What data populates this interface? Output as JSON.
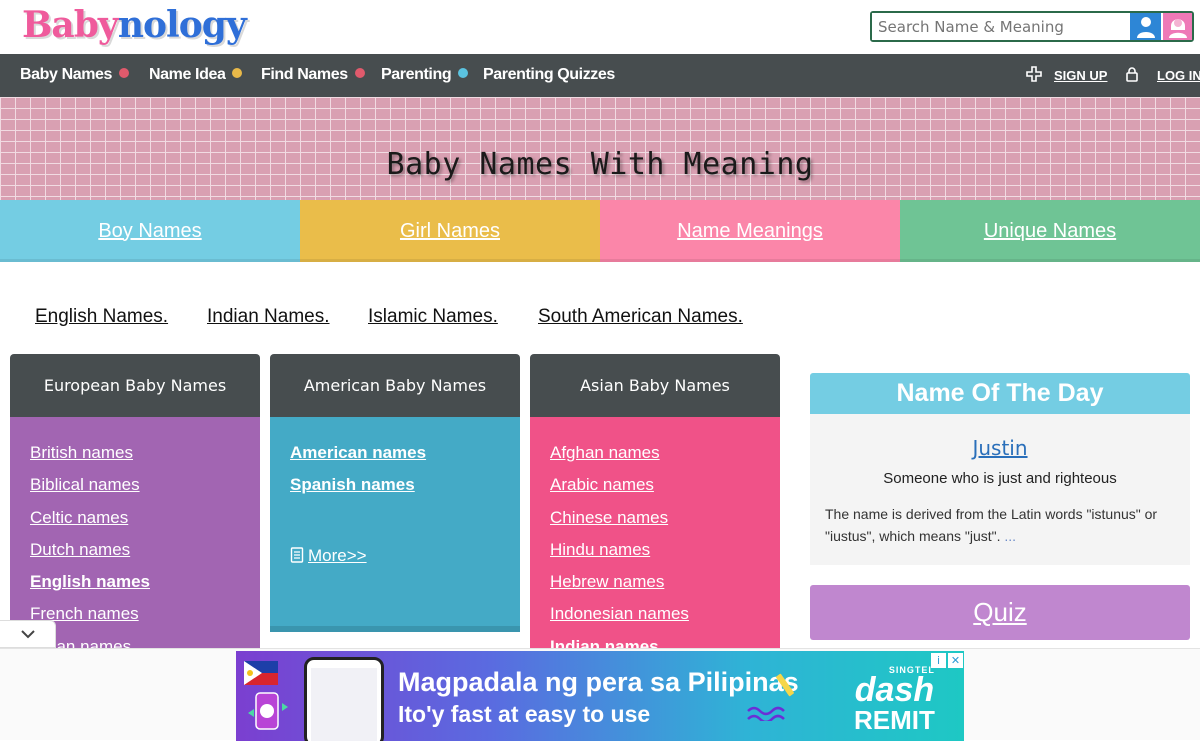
{
  "logo": {
    "part1": "Baby",
    "part2": "nology"
  },
  "search": {
    "placeholder": "Search Name & Meaning"
  },
  "nav": {
    "items": [
      {
        "label": "Baby Names",
        "dot": "#e05a6c"
      },
      {
        "label": "Name Idea",
        "dot": "#e9b949"
      },
      {
        "label": "Find Names",
        "dot": "#e05a6c"
      },
      {
        "label": "Parenting",
        "dot": "#5bc3e0"
      },
      {
        "label": "Parenting Quizzes"
      }
    ],
    "signup": "SIGN UP",
    "login": "LOG IN"
  },
  "hero": {
    "title": "Baby Names With Meaning"
  },
  "tabs": [
    {
      "label": "Boy Names",
      "color": "#74cde3"
    },
    {
      "label": "Girl Names",
      "color": "#eabd4a"
    },
    {
      "label": "Name Meanings",
      "color": "#fb86a9"
    },
    {
      "label": "Unique Names",
      "color": "#6fc495"
    }
  ],
  "regions": [
    "English Names.",
    "Indian Names.",
    "Islamic Names.",
    "South American Names."
  ],
  "cards": {
    "european": {
      "title": "European Baby Names",
      "color": "#a265b2",
      "links": [
        "British names",
        "Biblical names",
        "Celtic names",
        "Dutch names",
        "English names",
        "French names",
        "Italian names"
      ]
    },
    "american": {
      "title": "American Baby Names",
      "color": "#44aac6",
      "links": [
        "American names",
        "Spanish names"
      ],
      "more": "More>>"
    },
    "asian": {
      "title": "Asian Baby Names",
      "color": "#f05288",
      "links": [
        "Afghan names",
        "Arabic names",
        "Chinese names",
        "Hindu names",
        "Hebrew names",
        "Indonesian names",
        "Indian names"
      ]
    }
  },
  "name_of_the_day": {
    "heading": "Name Of The Day",
    "name": "Justin",
    "meaning": "Someone who is just and righteous",
    "description": "The name is derived from the Latin words \"istunus\" or \"iustus\", which means \"just\".",
    "more": "..."
  },
  "quiz": {
    "label": "Quiz"
  },
  "ad": {
    "headline": "Magpadala ng pera sa Pilipinas",
    "sub": "Ito'y fast at easy to use",
    "brand_small": "SINGTEL",
    "brand": "dash",
    "brand_sub": "REMIT"
  }
}
